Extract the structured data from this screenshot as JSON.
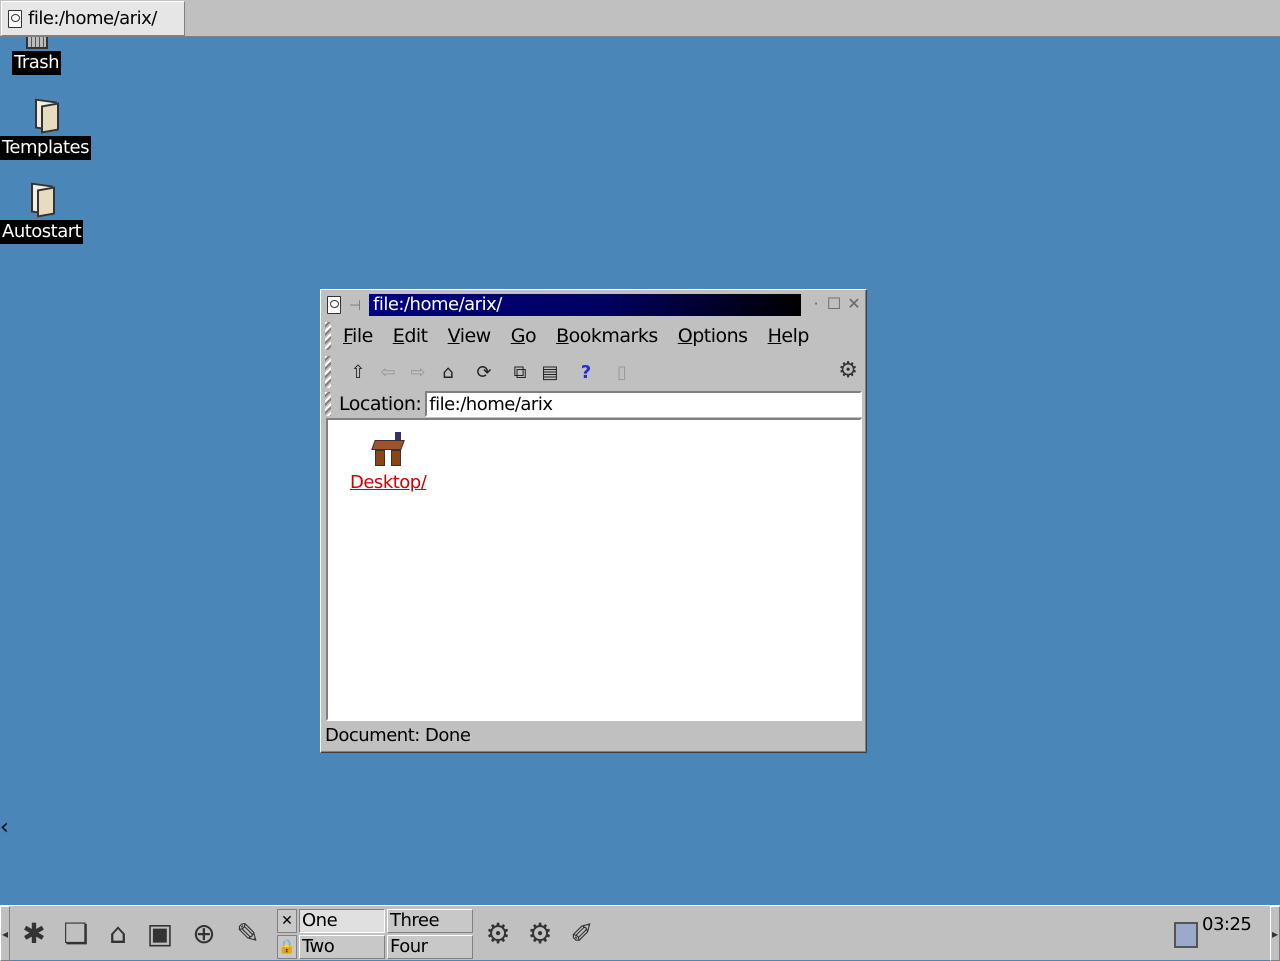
{
  "top_taskbar": {
    "task_label": "file:/home/arix/"
  },
  "desktop": {
    "icons": [
      {
        "label": "Trash",
        "icon": "trash-icon"
      },
      {
        "label": "Templates",
        "icon": "folder-icon"
      },
      {
        "label": "Autostart",
        "icon": "folder-icon"
      }
    ]
  },
  "window": {
    "title": "file:/home/arix/",
    "menu": [
      {
        "pre": "",
        "u": "F",
        "post": "ile"
      },
      {
        "pre": "",
        "u": "E",
        "post": "dit"
      },
      {
        "pre": "",
        "u": "V",
        "post": "iew"
      },
      {
        "pre": "",
        "u": "G",
        "post": "o"
      },
      {
        "pre": "",
        "u": "B",
        "post": "ookmarks"
      },
      {
        "pre": "",
        "u": "O",
        "post": "ptions"
      },
      {
        "pre": "",
        "u": "H",
        "post": "elp"
      }
    ],
    "toolbar_icons": [
      "up-arrow-icon",
      "back-arrow-icon",
      "forward-arrow-icon",
      "home-icon",
      "reload-icon",
      "copy-icon",
      "paste-icon",
      "help-icon",
      "stop-icon",
      "gear-icon"
    ],
    "location": {
      "label": "Location:",
      "value": "file:/home/arix"
    },
    "content_items": [
      {
        "label": "Desktop/",
        "icon": "desktop-folder-icon"
      }
    ],
    "status": "Document: Done"
  },
  "panel": {
    "desktops": [
      "One",
      "Two",
      "Three",
      "Four"
    ],
    "clock": "03:25"
  }
}
